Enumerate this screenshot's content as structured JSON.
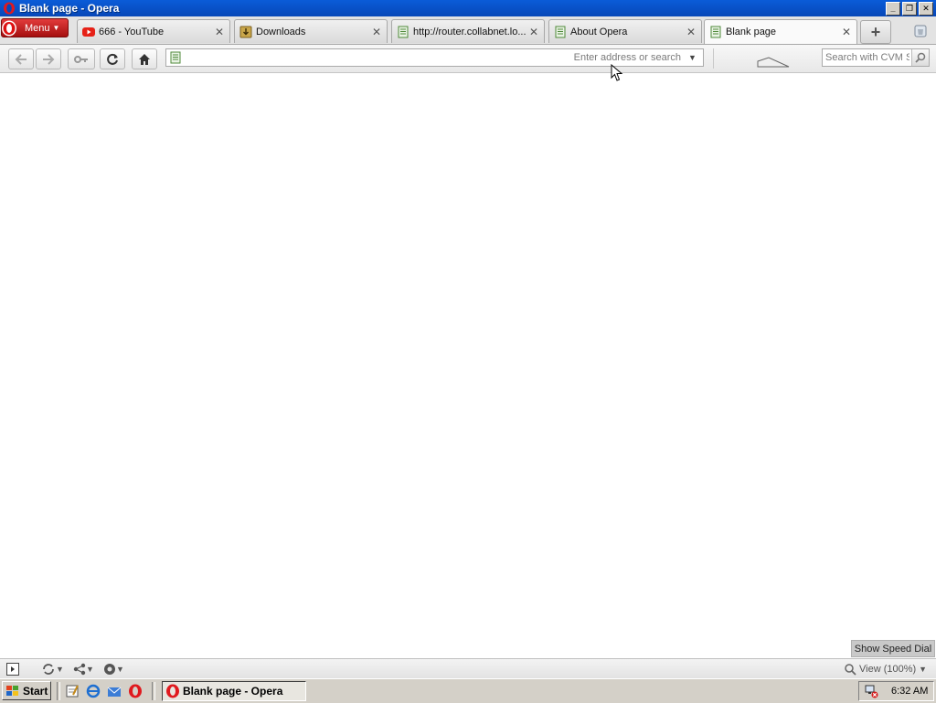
{
  "window": {
    "title": "Blank page - Opera",
    "accent_color": "#0a5cd8"
  },
  "menu": {
    "label": "Menu"
  },
  "tabs": [
    {
      "label": "666 - YouTube",
      "icon": "youtube-icon",
      "active": false
    },
    {
      "label": "Downloads",
      "icon": "downloads-icon",
      "active": false
    },
    {
      "label": "http://router.collabnet.lo...",
      "icon": "page-icon",
      "active": false
    },
    {
      "label": "About Opera",
      "icon": "page-icon",
      "active": false
    },
    {
      "label": "Blank page",
      "icon": "page-icon",
      "active": true
    }
  ],
  "address": {
    "placeholder": "Enter address or search",
    "value": ""
  },
  "search": {
    "placeholder": "Search with CVM S"
  },
  "statusbar": {
    "speed_dial_label": "Show Speed Dial",
    "zoom_label": "View (100%)"
  },
  "taskbar": {
    "start_label": "Start",
    "task_label": "Blank page - Opera",
    "clock": "6:32 AM"
  }
}
